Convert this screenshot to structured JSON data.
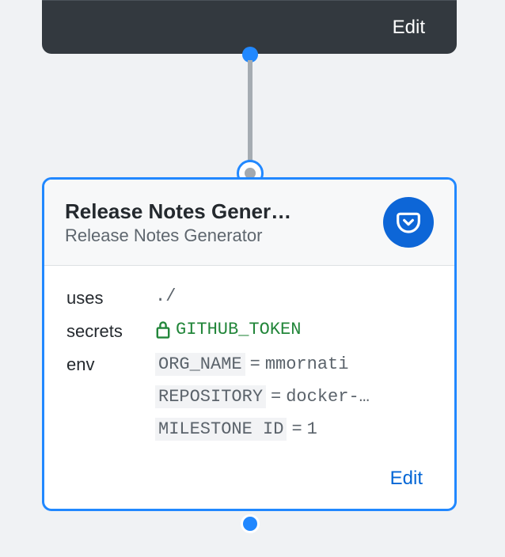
{
  "top_card": {
    "edit_label": "Edit"
  },
  "node": {
    "title": "Release Notes Gener…",
    "subtitle": "Release Notes Generator",
    "edit_label": "Edit",
    "uses_label": "uses",
    "uses_value": "./",
    "secrets_label": "secrets",
    "secrets_value": "GITHUB_TOKEN",
    "env_label": "env",
    "env": [
      {
        "key": "ORG_NAME",
        "value": "mmornati"
      },
      {
        "key": "REPOSITORY",
        "value": "docker-…"
      },
      {
        "key": "MILESTONE ID",
        "value": "1"
      }
    ]
  }
}
